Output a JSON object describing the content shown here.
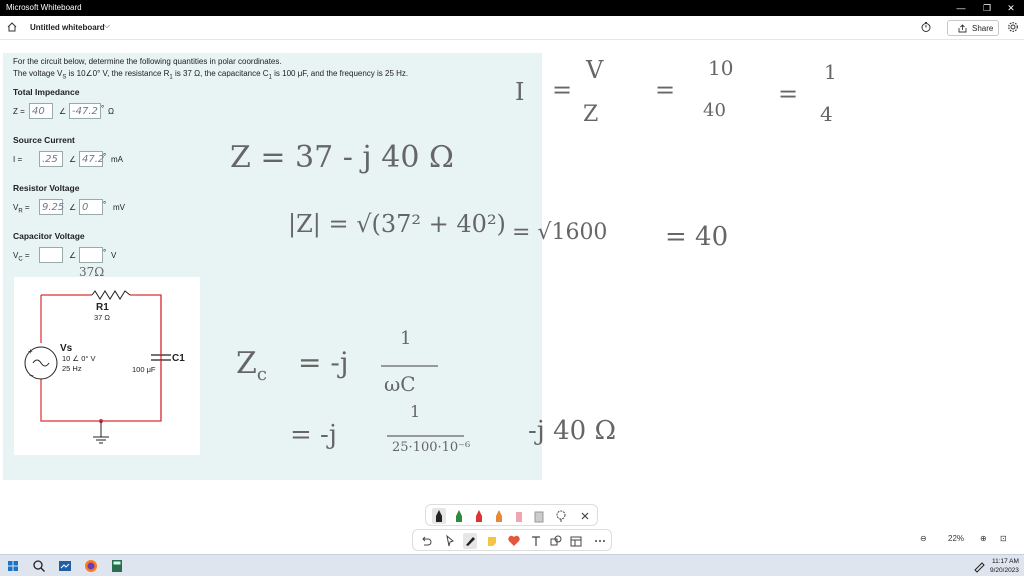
{
  "window": {
    "title": "Microsoft Whiteboard",
    "controls": [
      "—",
      "❐",
      "✕"
    ]
  },
  "appbar": {
    "whiteboard_name": "Untitled whiteboard",
    "chevron": "⌵",
    "share_label": "Share"
  },
  "problem": {
    "line1": "For the circuit below, determine the following quantities in polar coordinates.",
    "line2": "The voltage V",
    "line2_sub": "S",
    "line2_rest": " is 10∠0° V, the resistance R",
    "line2_sub2": "1",
    "line2_rest2": " is 37 Ω, the capacitance C",
    "line2_sub3": "1",
    "line2_rest3": " is 100 μF, and the frequency is 25 Hz.",
    "sections": [
      {
        "title": "Total Impedance",
        "symbol": "Z =",
        "mag": "40",
        "ang": "-47.2",
        "unit": "Ω"
      },
      {
        "title": "Source Current",
        "symbol": "I =",
        "mag": ".25",
        "ang": "47.2",
        "unit": "mA"
      },
      {
        "title": "Resistor Voltage",
        "symbol": "V",
        "symbol_sub": "R",
        "symbol_eq": " =",
        "mag": "9.25",
        "ang": "0",
        "unit": "mV"
      },
      {
        "title": "Capacitor Voltage",
        "symbol": "V",
        "symbol_sub": "C",
        "symbol_eq": " =",
        "mag": "",
        "ang": "",
        "unit": "V"
      }
    ],
    "angle_sign": "∠",
    "degree": "°"
  },
  "circuit": {
    "r1_name": "R1",
    "r1_value": "37 Ω",
    "vs_name": "Vs",
    "vs_value": "10 ∠ 0° V",
    "vs_freq": "25 Hz",
    "c1_name": "C1",
    "c1_value": "100 μF",
    "handwritten_r": "37Ω"
  },
  "ink": {
    "eq1": [
      "I",
      "=",
      "V",
      "Z",
      "=",
      "10",
      "40",
      "=",
      "1",
      "4"
    ],
    "eq2": "Z = 37 - j 40 Ω",
    "eq3_left": "|Z| = √(37² + 40²)",
    "eq3_mid": "= √1600",
    "eq3_right": "= 40",
    "eq4_left": "Z",
    "eq4_sub": "c",
    "eq4_rest": "= -j",
    "eq4_num": "1",
    "eq4_den": "ωC",
    "eq5_left": "= -j",
    "eq5_num": "1",
    "eq5_den": "25·100·10⁻⁶",
    "eq5_right": "-j 40 Ω"
  },
  "zoom": {
    "out": "⊖",
    "level": "22%",
    "in": "⊕",
    "fit": "⊡"
  },
  "taskbar": {
    "time": "11:17 AM",
    "date": "9/20/2023"
  }
}
